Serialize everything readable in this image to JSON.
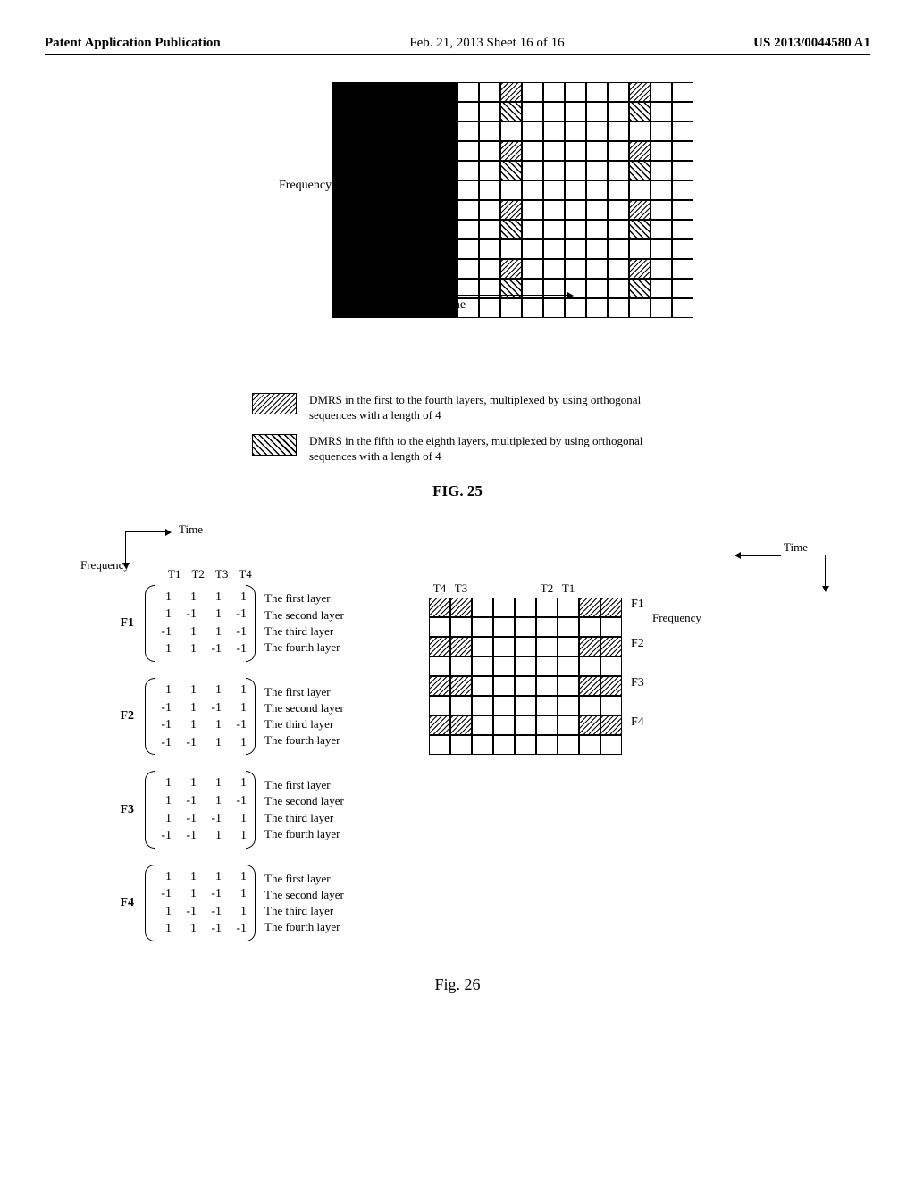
{
  "header": {
    "left": "Patent Application Publication",
    "mid": "Feb. 21, 2013  Sheet 16 of 16",
    "right": "US 2013/0044580 A1"
  },
  "fig25": {
    "ylabel": "Frequency",
    "xlabel": "Time",
    "legend1": "DMRS in the first to the fourth layers, multiplexed by using orthogonal sequences with a length of 4",
    "legend2": "DMRS in the fifth to the eighth layers, multiplexed by using orthogonal sequences with a length of 4",
    "caption": "FIG. 25"
  },
  "fig26": {
    "time": "Time",
    "freq": "Frequency",
    "thdr": [
      "T1",
      "T2",
      "T3",
      "T4"
    ],
    "layers": [
      "The first layer",
      "The second layer",
      "The third layer",
      "The fourth layer"
    ],
    "rthdr_right": [
      "T4",
      "T3",
      "T2",
      "T1"
    ],
    "flabels": [
      "F1",
      "F2",
      "F3",
      "F4"
    ],
    "caption": "Fig. 26"
  },
  "chart_data": {
    "type": "table",
    "description": "Orthogonal code matrices for DMRS layers across 4 frequency positions F1-F4 and 4 time positions T1-T4",
    "matrices": [
      {
        "freq": "F1",
        "rows": [
          [
            1,
            1,
            1,
            1
          ],
          [
            1,
            -1,
            1,
            -1
          ],
          [
            -1,
            1,
            1,
            -1
          ],
          [
            1,
            1,
            -1,
            -1
          ]
        ],
        "layers": [
          "The first layer",
          "The second layer",
          "The third layer",
          "The fourth layer"
        ]
      },
      {
        "freq": "F2",
        "rows": [
          [
            1,
            1,
            1,
            1
          ],
          [
            -1,
            1,
            -1,
            1
          ],
          [
            -1,
            1,
            1,
            -1
          ],
          [
            -1,
            -1,
            1,
            1
          ]
        ],
        "layers": [
          "The first layer",
          "The second layer",
          "The third layer",
          "The fourth layer"
        ]
      },
      {
        "freq": "F3",
        "rows": [
          [
            1,
            1,
            1,
            1
          ],
          [
            1,
            -1,
            1,
            -1
          ],
          [
            1,
            -1,
            -1,
            1
          ],
          [
            -1,
            -1,
            1,
            1
          ]
        ],
        "layers": [
          "The first layer",
          "The second layer",
          "The third layer",
          "The fourth layer"
        ]
      },
      {
        "freq": "F4",
        "rows": [
          [
            1,
            1,
            1,
            1
          ],
          [
            -1,
            1,
            -1,
            1
          ],
          [
            1,
            -1,
            -1,
            1
          ],
          [
            1,
            1,
            -1,
            -1
          ]
        ],
        "layers": [
          "The first layer",
          "The second layer",
          "The third layer",
          "The fourth layer"
        ]
      }
    ],
    "grid25": {
      "rows": 12,
      "cols": 11,
      "hatch1_cols": [
        2,
        8
      ],
      "hatch1_row_offset": 0,
      "hatch2_cols": [
        2,
        8
      ],
      "hatch2_row_offset": 1,
      "row_pairs": [
        [
          0,
          1
        ],
        [
          3,
          4
        ],
        [
          6,
          7
        ],
        [
          9,
          10
        ]
      ]
    },
    "grid26_right": {
      "rows": 8,
      "cols": 9,
      "hatch_rows": [
        0,
        2,
        4,
        6
      ],
      "hatch_cols": [
        0,
        1,
        7,
        8
      ]
    }
  }
}
